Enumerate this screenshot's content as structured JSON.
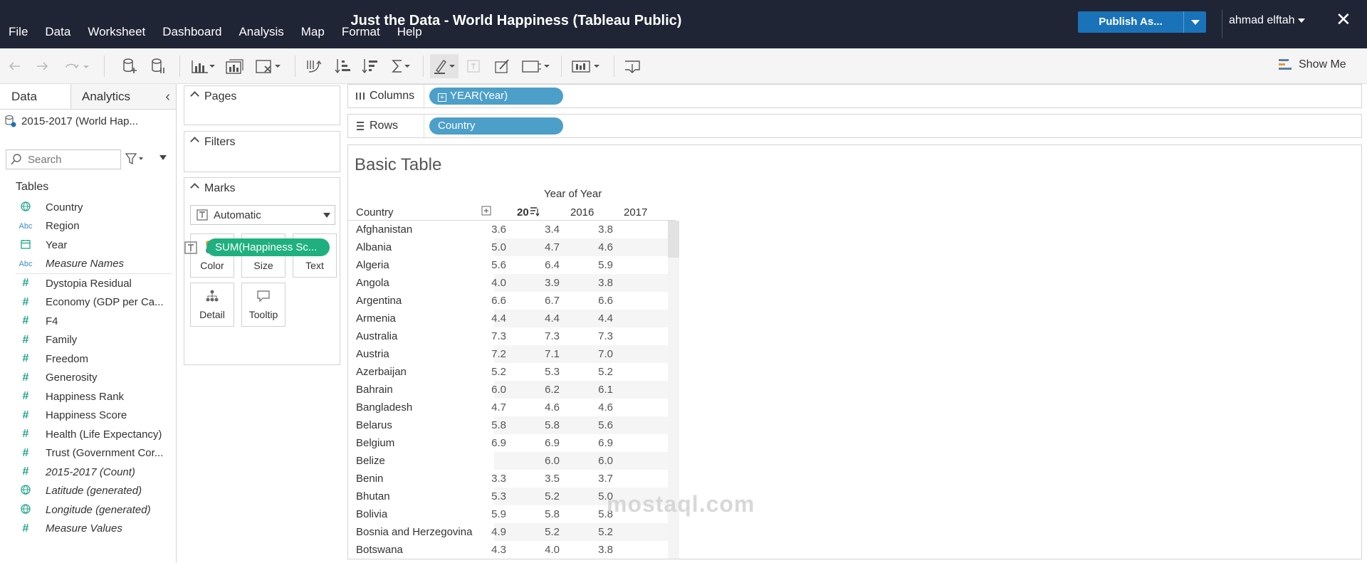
{
  "menu": [
    "File",
    "Data",
    "Worksheet",
    "Dashboard",
    "Analysis",
    "Map",
    "Format",
    "Help"
  ],
  "title": "Just the Data - World Happiness (Tableau Public)",
  "publish_label": "Publish As...",
  "user_name": "ahmad elftah",
  "close_glyph": "✕",
  "show_me": "Show Me",
  "tabs": {
    "data": "Data",
    "analytics": "Analytics"
  },
  "datasource": "2015-2017 (World Hap...",
  "search_placeholder": "Search",
  "tables_heading": "Tables",
  "dimensions": [
    {
      "label": "Country",
      "icon": "globe-icon",
      "italic": false
    },
    {
      "label": "Region",
      "icon": "abc-icon",
      "italic": false
    },
    {
      "label": "Year",
      "icon": "calendar-icon",
      "italic": false
    },
    {
      "label": "Measure Names",
      "icon": "abc-icon",
      "italic": true
    }
  ],
  "measures": [
    {
      "label": "Dystopia Residual",
      "icon": "hash-icon",
      "italic": false
    },
    {
      "label": "Economy (GDP per Ca...",
      "icon": "hash-icon",
      "italic": false
    },
    {
      "label": "F4",
      "icon": "hash-icon",
      "italic": false
    },
    {
      "label": "Family",
      "icon": "hash-icon",
      "italic": false
    },
    {
      "label": "Freedom",
      "icon": "hash-icon",
      "italic": false
    },
    {
      "label": "Generosity",
      "icon": "hash-icon",
      "italic": false
    },
    {
      "label": "Happiness Rank",
      "icon": "hash-icon",
      "italic": false
    },
    {
      "label": "Happiness Score",
      "icon": "hash-icon",
      "italic": false
    },
    {
      "label": "Health (Life Expectancy)",
      "icon": "hash-icon",
      "italic": false
    },
    {
      "label": "Trust (Government Cor...",
      "icon": "hash-icon",
      "italic": false
    },
    {
      "label": "2015-2017 (Count)",
      "icon": "hash-icon",
      "italic": true
    },
    {
      "label": "Latitude (generated)",
      "icon": "globe-icon",
      "italic": true
    },
    {
      "label": "Longitude (generated)",
      "icon": "globe-icon",
      "italic": true
    },
    {
      "label": "Measure Values",
      "icon": "hash-icon",
      "italic": true
    }
  ],
  "cards": {
    "pages": "Pages",
    "filters": "Filters",
    "marks": "Marks"
  },
  "marks": {
    "type": "Automatic",
    "buttons": {
      "color": "Color",
      "size": "Size",
      "text": "Text",
      "detail": "Detail",
      "tooltip": "Tooltip"
    },
    "pill": "SUM(Happiness Sc..."
  },
  "shelves": {
    "columns_label": "Columns",
    "columns_pill": "YEAR(Year)",
    "rows_label": "Rows",
    "rows_pill": "Country"
  },
  "sheet_title": "Basic Table",
  "table": {
    "column_group": "Year of Year",
    "row_header": "Country",
    "years": [
      "20",
      "2016",
      "2017"
    ],
    "rows": [
      {
        "country": "Afghanistan",
        "v": [
          "3.6",
          "3.4",
          "3.8"
        ]
      },
      {
        "country": "Albania",
        "v": [
          "5.0",
          "4.7",
          "4.6"
        ]
      },
      {
        "country": "Algeria",
        "v": [
          "5.6",
          "6.4",
          "5.9"
        ]
      },
      {
        "country": "Angola",
        "v": [
          "4.0",
          "3.9",
          "3.8"
        ]
      },
      {
        "country": "Argentina",
        "v": [
          "6.6",
          "6.7",
          "6.6"
        ]
      },
      {
        "country": "Armenia",
        "v": [
          "4.4",
          "4.4",
          "4.4"
        ]
      },
      {
        "country": "Australia",
        "v": [
          "7.3",
          "7.3",
          "7.3"
        ]
      },
      {
        "country": "Austria",
        "v": [
          "7.2",
          "7.1",
          "7.0"
        ]
      },
      {
        "country": "Azerbaijan",
        "v": [
          "5.2",
          "5.3",
          "5.2"
        ]
      },
      {
        "country": "Bahrain",
        "v": [
          "6.0",
          "6.2",
          "6.1"
        ]
      },
      {
        "country": "Bangladesh",
        "v": [
          "4.7",
          "4.6",
          "4.6"
        ]
      },
      {
        "country": "Belarus",
        "v": [
          "5.8",
          "5.8",
          "5.6"
        ]
      },
      {
        "country": "Belgium",
        "v": [
          "6.9",
          "6.9",
          "6.9"
        ]
      },
      {
        "country": "Belize",
        "v": [
          "",
          "6.0",
          "6.0"
        ]
      },
      {
        "country": "Benin",
        "v": [
          "3.3",
          "3.5",
          "3.7"
        ]
      },
      {
        "country": "Bhutan",
        "v": [
          "5.3",
          "5.2",
          "5.0"
        ]
      },
      {
        "country": "Bolivia",
        "v": [
          "5.9",
          "5.8",
          "5.8"
        ]
      },
      {
        "country": "Bosnia and Herzegovina",
        "v": [
          "4.9",
          "5.2",
          "5.2"
        ]
      },
      {
        "country": "Botswana",
        "v": [
          "4.3",
          "4.0",
          "3.8"
        ]
      }
    ]
  },
  "watermark": "mostaql.com",
  "colors": {
    "topbar": "#1f2535",
    "publish": "#1a73b9",
    "dim_pill": "#4c9fc9",
    "measure_pill": "#20b07f",
    "row_shade": "#f5f5f5"
  }
}
